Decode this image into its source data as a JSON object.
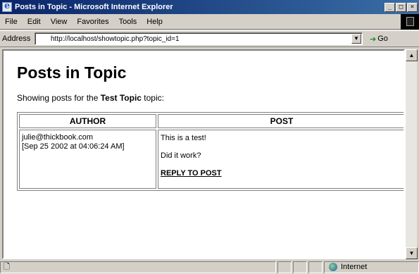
{
  "window": {
    "title": "Posts in Topic - Microsoft Internet Explorer",
    "buttons": [
      "_",
      "□",
      "×"
    ]
  },
  "menu": {
    "items": [
      "File",
      "Edit",
      "View",
      "Favorites",
      "Tools",
      "Help"
    ]
  },
  "address": {
    "label": "Address",
    "url": "http://localhost/showtopic.php?topic_id=1",
    "go_label": "Go"
  },
  "page": {
    "title": "Posts in Topic",
    "intro_prefix": "Showing posts for the ",
    "topic_name": "Test Topic",
    "intro_suffix": " topic:",
    "columns": [
      "AUTHOR",
      "POST"
    ],
    "posts": [
      {
        "author": "julie@thickbook.com",
        "date": "[Sep 25 2002 at 04:06:24 AM]",
        "lines": [
          "This is a test!",
          "Did it work?"
        ],
        "reply_label": "REPLY TO POST"
      }
    ]
  },
  "status": {
    "zone": "Internet"
  }
}
